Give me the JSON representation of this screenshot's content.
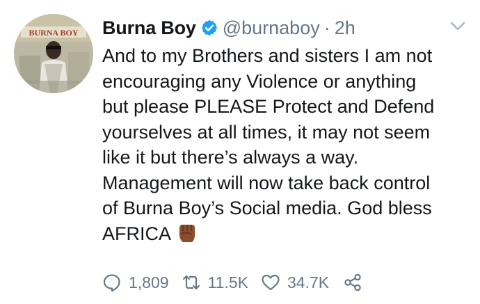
{
  "user": {
    "name": "Burna Boy",
    "handle": "@burnaboy",
    "separator": "·",
    "time": "2h"
  },
  "tweet": {
    "text": "And to my Brothers and sisters I am not\nencouraging any Violence or anything\nbut please PLEASE Protect and Defend\nyourselves at all times, it may not seem\nlike it but there’s always a way.\nManagement will now take back control\nof Burna Boy’s Social media. God bless\nAFRICA"
  },
  "avatar": {
    "banner_text": "BURNA BOY"
  },
  "actions": {
    "replies": "1,809",
    "retweets": "11.5K",
    "likes": "34.7K"
  },
  "icons": [
    "verified-badge-icon",
    "chevron-down-icon",
    "raised-fist-emoji-icon",
    "reply-icon",
    "retweet-icon",
    "like-icon",
    "share-icon"
  ],
  "colors": {
    "verified": "#1da1f2",
    "muted": "#657786",
    "text": "#14171a"
  }
}
